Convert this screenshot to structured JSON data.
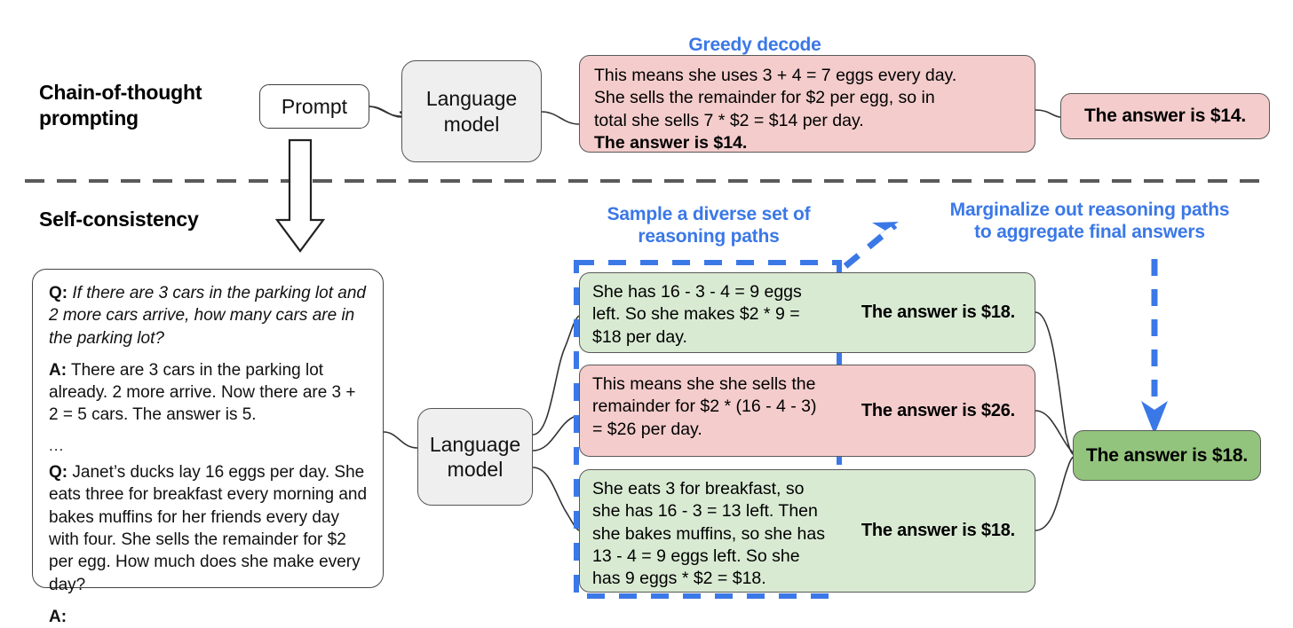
{
  "figure": {
    "sections": {
      "cot": {
        "title": "Chain-of-thought\nprompting",
        "title_line1": "Chain-of-thought",
        "title_line2": "prompting"
      },
      "sc": {
        "title": "Self-consistency"
      }
    },
    "captions": {
      "greedy": "Greedy decode",
      "sample_line1": "Sample a diverse set of",
      "sample_line2": "reasoning paths",
      "marginalize_line1": "Marginalize out reasoning paths",
      "marginalize_line2": "to aggregate final answers"
    },
    "nodes": {
      "prompt": "Prompt",
      "language_model_line1": "Language",
      "language_model_line2": "model",
      "language_model_2_line1": "Language",
      "language_model_2_line2": "model"
    },
    "cot_output": {
      "line1": "This means she uses 3 + 4 = 7 eggs every day.",
      "line2": "She sells the remainder for $2 per egg, so in",
      "line3": "total she sells 7 * $2 = $14 per day.",
      "line4": "The answer is $14."
    },
    "cot_final_answer": "The answer is $14.",
    "prompt_panel": {
      "q1_label": "Q:",
      "q1_text": "If there are 3 cars in the parking lot and 2 more cars arrive, how many cars are in the parking lot?",
      "a1_label": "A:",
      "a1_text": "There are 3 cars in the parking lot already. 2 more arrive. Now there are 3 + 2 = 5 cars. The answer is 5.",
      "ellipsis": "...",
      "q2_label": "Q:",
      "q2_text": "Janet’s ducks lay 16 eggs per day. She eats three for breakfast every morning and bakes muffins for her friends every day with four. She sells the remainder for $2 per egg. How much does she make every day?",
      "a2_label": "A:"
    },
    "reasoning_paths": [
      {
        "id": "path-1",
        "color": "green",
        "reasoning": "She has 16 - 3 - 4 = 9 eggs left. So she makes $2 * 9 = $18 per day.",
        "answer": "The answer is $18."
      },
      {
        "id": "path-2",
        "color": "pink",
        "reasoning": "This means she she sells the remainder for $2 * (16 - 4 - 3) = $26 per day.",
        "answer": "The answer is $26."
      },
      {
        "id": "path-3",
        "color": "green",
        "reasoning": "She eats 3 for breakfast, so she has 16 - 3 = 13 left. Then she bakes muffins, so she has 13 - 4 = 9 eggs left. So she has 9 eggs * $2 = $18.",
        "answer": "The answer is $18."
      }
    ],
    "final_answer": "The answer is $18.",
    "colors": {
      "accent_blue": "#3B78E7",
      "pink_fill": "#F4CCCC",
      "green_fill": "#D9EAD3",
      "final_green_fill": "#93C47D",
      "node_gray_fill": "#EFEFEF",
      "outline": "#3F3F3F"
    }
  }
}
